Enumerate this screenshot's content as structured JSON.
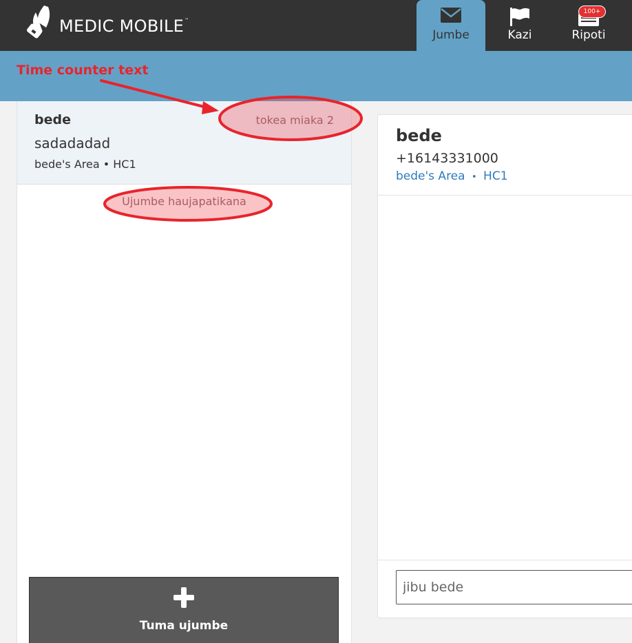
{
  "header": {
    "brand": "MEDIC MOBILE",
    "trademark": "™",
    "tabs": [
      {
        "label": "Jumbe",
        "icon": "envelope-icon",
        "active": true
      },
      {
        "label": "Kazi",
        "icon": "flag-icon",
        "active": false
      },
      {
        "label": "Ripoti",
        "icon": "reports-icon",
        "active": false,
        "badge": "100+"
      }
    ]
  },
  "annotation": {
    "label": "Time counter text"
  },
  "message_list": {
    "items": [
      {
        "name": "bede",
        "time": "tokea miaka 2",
        "text": "sadadadad",
        "place": "bede's Area • HC1"
      }
    ],
    "no_more": "Ujumbe haujapatikana",
    "send_button": "Tuma ujumbe"
  },
  "detail": {
    "name": "bede",
    "phone": "+16143331000",
    "place_area": "bede's Area",
    "place_sep": "•",
    "place_hc": "HC1",
    "reply_placeholder": "jibu bede"
  },
  "colors": {
    "header_bg": "#333333",
    "accent_blue": "#63a2c6",
    "link_blue": "#2f7bbd",
    "annotation_red": "#e8242c",
    "badge_red": "#e33030"
  }
}
